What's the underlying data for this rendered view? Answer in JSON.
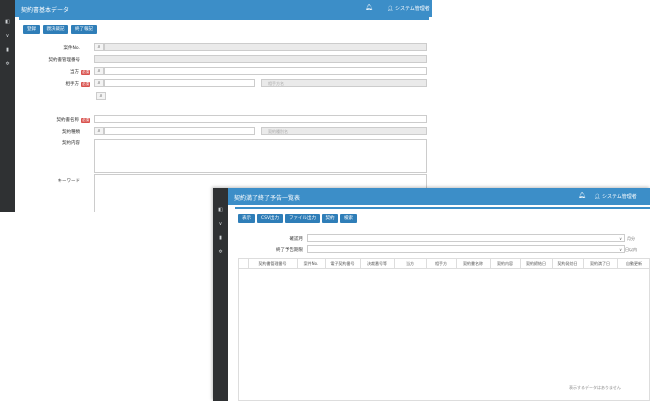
{
  "win1": {
    "title": "契約書基本データ",
    "user": "システム管理者",
    "buttons": [
      "登録",
      "親決裁記",
      "終了報記"
    ],
    "fields": {
      "case_no": "案件No.",
      "mgmt_no": "契約書管理番号",
      "party_a": "当方",
      "party_b": "相手方",
      "party_b_placeholder": "相手方名",
      "name": "契約書名称",
      "type": "契約種類",
      "type_placeholder": "契約種別名",
      "content": "契約内容",
      "keyword": "キーワード"
    },
    "required": "必須"
  },
  "win2": {
    "title": "契約満了終了予告一覧表",
    "user": "システム管理者",
    "buttons": [
      "表示",
      "CSV出力",
      "ファイル出力",
      "契約",
      "検索"
    ],
    "filters": {
      "period_label": "確認月",
      "period_unit": "月分",
      "end_label": "終了予告期限",
      "end_unit": "日以内"
    },
    "columns": [
      "契約書管理番号",
      "案件No.",
      "電子契約番号",
      "決裁番号等",
      "当方",
      "相手方",
      "契約書名称",
      "契約内容",
      "契約締結日",
      "契約発効日",
      "契約満了日",
      "自動更新"
    ],
    "footer": "表示するデータはありません"
  }
}
